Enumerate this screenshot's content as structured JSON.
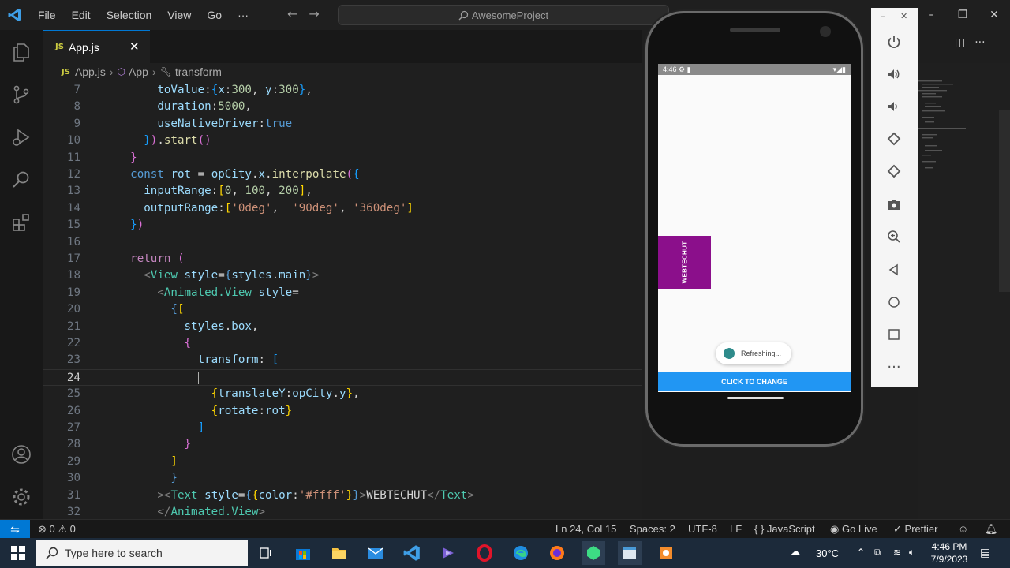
{
  "window": {
    "menu": [
      "File",
      "Edit",
      "Selection",
      "View",
      "Go",
      "···"
    ],
    "search_text": "AwesomeProject"
  },
  "tab": {
    "label": "App.js",
    "badge": "JS"
  },
  "breadcrumb": {
    "file": "App.js",
    "component": "App",
    "symbol": "transform"
  },
  "editor": {
    "current_line": "24",
    "line_numbers": [
      "7",
      "8",
      "9",
      "10",
      "11",
      "12",
      "13",
      "14",
      "15",
      "16",
      "17",
      "18",
      "19",
      "20",
      "21",
      "22",
      "23",
      "24",
      "25",
      "26",
      "27",
      "28",
      "29",
      "30",
      "31",
      "32"
    ]
  },
  "statusbar": {
    "errors": "0",
    "warnings": "0",
    "cursor": "Ln 24, Col 15",
    "spaces": "Spaces: 2",
    "encoding": "UTF-8",
    "eol": "LF",
    "language": "JavaScript",
    "golive": "Go Live",
    "prettier": "Prettier"
  },
  "taskbar": {
    "search_placeholder": "Type here to search",
    "temperature": "30°C",
    "time": "4:46 PM",
    "date": "7/9/2023"
  },
  "phone": {
    "clock": "4:46",
    "box_text": "WEBTECHUT",
    "toast": "Refreshing...",
    "button": "CLICK TO CHANGE"
  },
  "colors": {
    "accent": "#0078d4",
    "box": "#8b0f8b",
    "button": "#2196f3"
  }
}
